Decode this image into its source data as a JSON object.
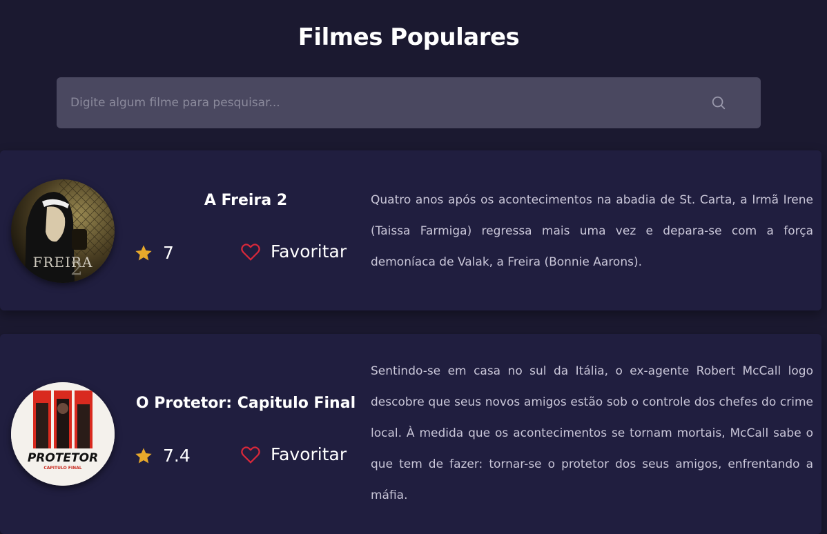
{
  "page": {
    "title": "Filmes Populares"
  },
  "search": {
    "placeholder": "Digite algum filme para pesquisar..."
  },
  "movies": [
    {
      "title": "A Freira 2",
      "rating": "7",
      "favorite_label": "Favoritar",
      "overview": "Quatro anos após os acontecimentos na abadia de St. Carta, a Irmã Irene (Taissa Farmiga) regressa mais uma vez e depara-se com a força demoníaca de Valak, a Freira (Bonnie Aarons).",
      "poster_text": "FREIRA",
      "poster_number": "2"
    },
    {
      "title": "O Protetor: Capitulo Final",
      "rating": "7.4",
      "favorite_label": "Favoritar",
      "overview": "Sentindo-se em casa no sul da Itália, o ex-agente Robert McCall logo descobre que seus novos amigos estão sob o controle dos chefes do crime local. À medida que os acontecimentos se tornam mortais, McCall sabe o que tem de fazer: tornar-se o protetor dos seus amigos, enfrentando a máfia.",
      "poster_text": "PROTETOR",
      "poster_subtext": "CAPITULO FINAL"
    }
  ],
  "colors": {
    "background": "#1b1930",
    "card": "#201e3f",
    "search_bg": "#4a4860",
    "star": "#e6a82b",
    "heart": "#d9283a",
    "text_muted": "#c9c6d8"
  },
  "icons": {
    "search": "search-icon",
    "star": "star-icon",
    "favorite": "heart-icon"
  }
}
